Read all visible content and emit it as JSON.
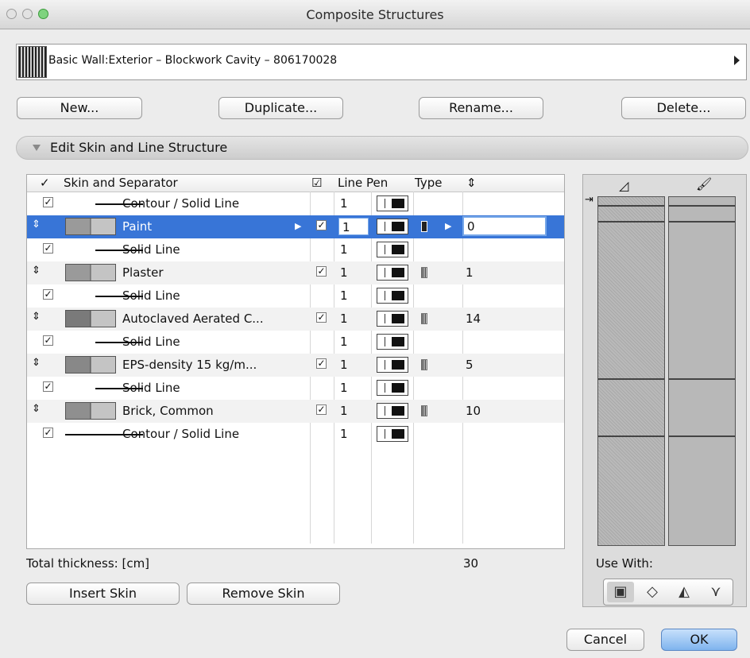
{
  "window": {
    "title": "Composite Structures"
  },
  "selector": {
    "label": "Basic Wall:Exterior – Blockwork Cavity – 806170028"
  },
  "toolbar": {
    "new": "New...",
    "duplicate": "Duplicate...",
    "rename": "Rename...",
    "delete": "Delete..."
  },
  "section": {
    "label": "Edit Skin and Line Structure"
  },
  "table": {
    "headers": {
      "skin": "Skin and Separator",
      "line": "Line",
      "pen": "Pen",
      "type": "Type"
    },
    "rows": [
      {
        "kind": "line",
        "name": "Contour /  Solid Line",
        "pen_num": "1"
      },
      {
        "kind": "skin",
        "name": "Paint",
        "pen_num": "1",
        "thickness": "0",
        "selected": true
      },
      {
        "kind": "line",
        "name": "Solid Line",
        "pen_num": "1"
      },
      {
        "kind": "skin",
        "name": "Plaster",
        "pen_num": "1",
        "thickness": "1"
      },
      {
        "kind": "line",
        "name": "Solid Line",
        "pen_num": "1"
      },
      {
        "kind": "skin",
        "name": "Autoclaved Aerated C...",
        "pen_num": "1",
        "thickness": "14"
      },
      {
        "kind": "line",
        "name": "Solid Line",
        "pen_num": "1"
      },
      {
        "kind": "skin",
        "name": "EPS-density 15 kg/m...",
        "pen_num": "1",
        "thickness": "5"
      },
      {
        "kind": "line",
        "name": "Solid Line",
        "pen_num": "1"
      },
      {
        "kind": "skin",
        "name": "Brick, Common",
        "pen_num": "1",
        "thickness": "10"
      },
      {
        "kind": "line",
        "name": "Contour /  Solid Line",
        "pen_num": "1"
      }
    ]
  },
  "totals": {
    "label": "Total thickness: [cm]",
    "value": "30"
  },
  "skin_buttons": {
    "insert": "Insert Skin",
    "remove": "Remove Skin"
  },
  "use_with": {
    "label": "Use With:",
    "icons": [
      "wall-tool-icon",
      "slab-tool-icon",
      "roof-tool-icon",
      "shell-tool-icon"
    ]
  },
  "dialog": {
    "cancel": "Cancel",
    "ok": "OK"
  },
  "colors": {
    "selection": "#3875d7",
    "ok_button": "#7fb4ee"
  }
}
